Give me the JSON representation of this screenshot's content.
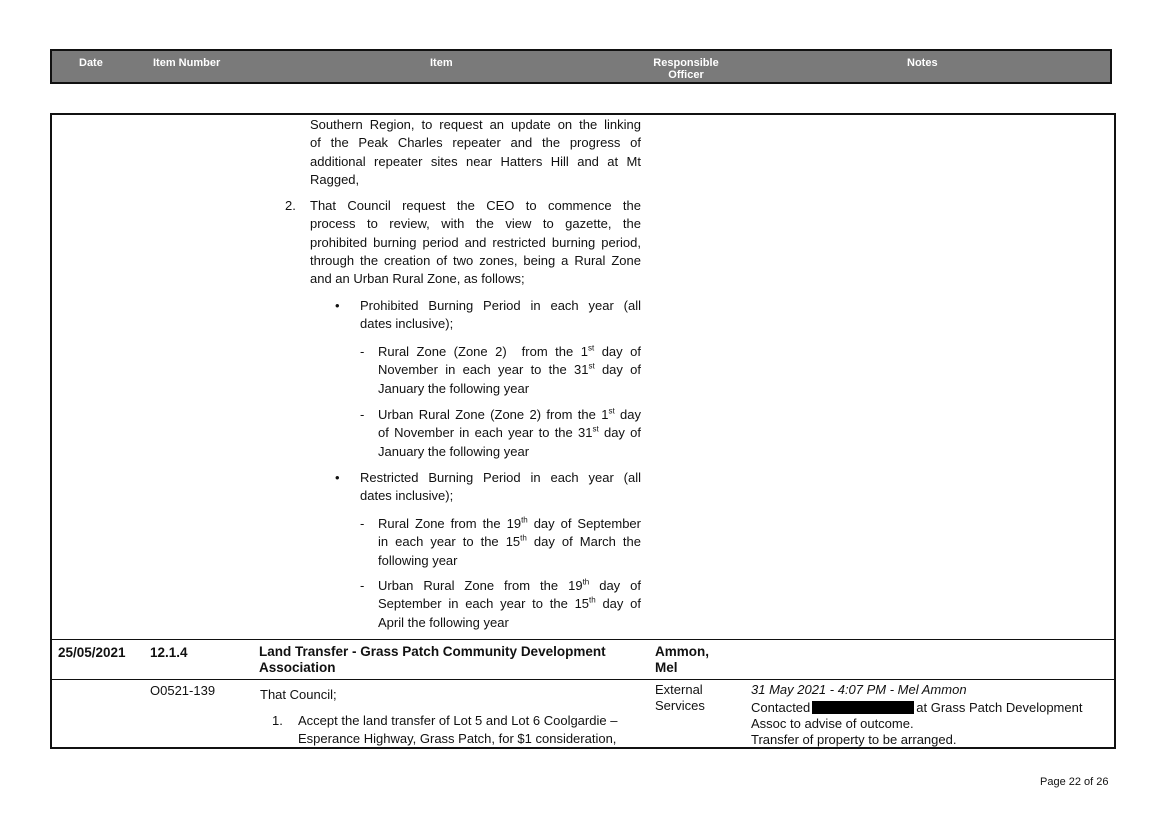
{
  "header": {
    "date": "Date",
    "item_number": "Item Number",
    "item": "Item",
    "officer_line1": "Responsible",
    "officer_line2": "Officer",
    "notes": "Notes"
  },
  "continued": {
    "para1": [
      "Southern Region, to request an update on the linking",
      "of the Peak Charles repeater and the progress of",
      "additional repeater sites near Hatters Hill and at Mt",
      "Ragged,"
    ],
    "item2_num": "2.",
    "item2": [
      "That Council request the CEO to commence the",
      "process to review, with the view to gazette, the",
      "prohibited burning period and restricted burning period,",
      "through the creation of two zones, being a Rural Zone",
      "and an Urban Rural Zone, as follows;"
    ],
    "bullet_char": "•",
    "dash_char": "-",
    "bullet1": [
      "Prohibited Burning Period in each year (all",
      "dates inclusive);"
    ],
    "bullet2": [
      "Restricted Burning Period in each year (all",
      "dates inclusive);"
    ]
  },
  "entry": {
    "date": "25/05/2021",
    "item_number": "12.1.4",
    "title_line1": "Land Transfer - Grass Patch Community Development",
    "title_line2": "Association",
    "officer_line1": "Ammon,",
    "officer_line2": "Mel",
    "ref": "O0521-139",
    "that_council": "That Council;",
    "item1_num": "1.",
    "item1_line1": "Accept the land transfer of Lot 5 and Lot 6 Coolgardie –",
    "item1_line2": "Esperance Highway, Grass Patch, for $1 consideration,",
    "responsible_line1": "External",
    "responsible_line2": "Services",
    "note_header": "31 May 2021 - 4:07 PM - Mel Ammon",
    "note_contacted": "Contacted",
    "note_at": "at Grass Patch Development",
    "note_line2": "Assoc to advise of outcome.",
    "note_line3": "Transfer of property to be arranged."
  },
  "footer": {
    "page": "Page 22 of 26"
  }
}
